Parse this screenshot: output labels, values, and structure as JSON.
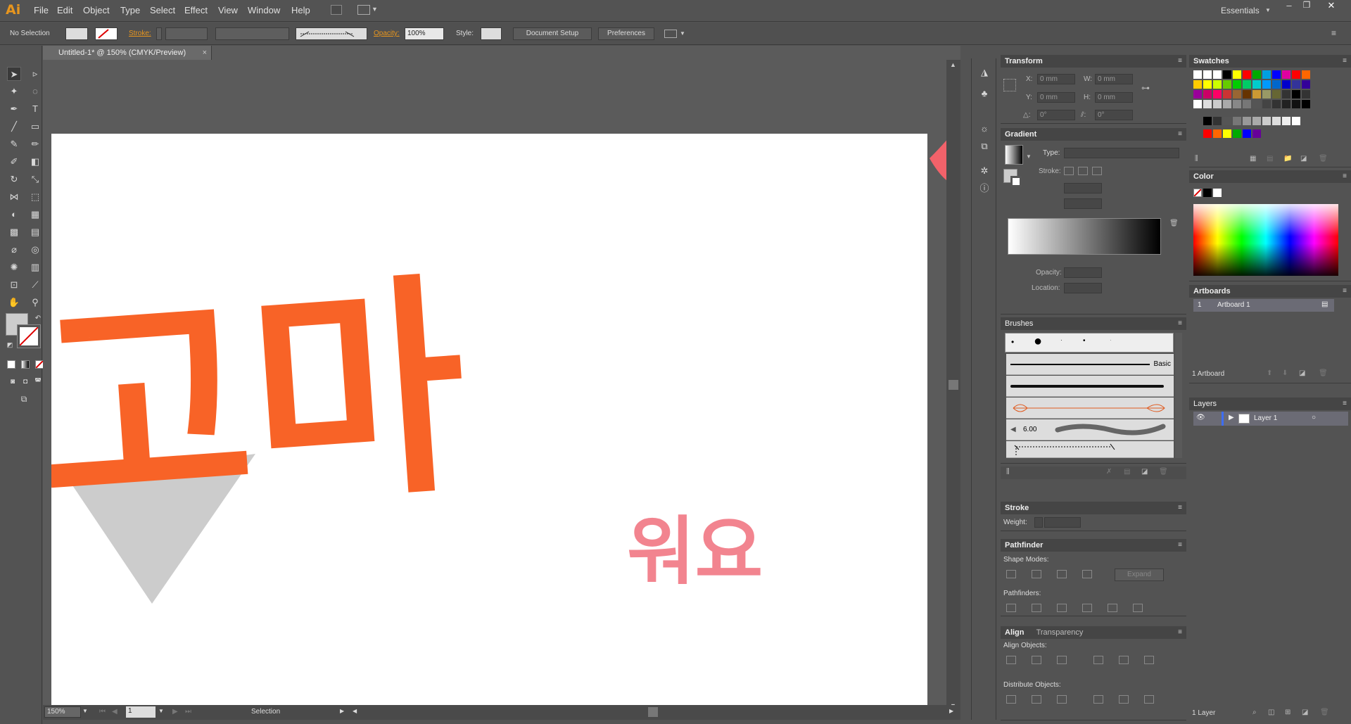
{
  "app": {
    "logo": "Ai",
    "workspace": "Essentials"
  },
  "menu": [
    "File",
    "Edit",
    "Object",
    "Type",
    "Select",
    "Effect",
    "View",
    "Window",
    "Help"
  ],
  "control": {
    "selection": "No Selection",
    "stroke_label": "Stroke:",
    "opacity_label": "Opacity:",
    "opacity_value": "100%",
    "style_label": "Style:",
    "doc_setup": "Document Setup",
    "preferences": "Preferences"
  },
  "document": {
    "tab_title": "Untitled-1* @ 150% (CMYK/Preview)"
  },
  "artwork": {
    "text1": "고마",
    "text2": "워요",
    "colors": {
      "orange": "#f86327",
      "pink": "#f2848f",
      "gray": "#cccccc"
    }
  },
  "status": {
    "zoom": "150%",
    "artboard_num": "1",
    "tool": "Selection"
  },
  "transform": {
    "title": "Transform",
    "x_label": "X:",
    "y_label": "Y:",
    "w_label": "W:",
    "h_label": "H:",
    "x": "0 mm",
    "y": "0 mm",
    "w": "0 mm",
    "h": "0 mm",
    "angle": "0°",
    "shear": "0°"
  },
  "gradient": {
    "title": "Gradient",
    "type_label": "Type:",
    "stroke_label": "Stroke:",
    "opacity_label": "Opacity:",
    "location_label": "Location:"
  },
  "brushes": {
    "title": "Brushes",
    "basic": "Basic",
    "size": "6.00"
  },
  "stroke": {
    "title": "Stroke",
    "weight_label": "Weight:"
  },
  "pathfinder": {
    "title": "Pathfinder",
    "shape_modes": "Shape Modes:",
    "pathfinders": "Pathfinders:",
    "expand": "Expand"
  },
  "align": {
    "title": "Align",
    "tab2": "Transparency",
    "align_objects": "Align Objects:",
    "distribute_objects": "Distribute Objects:"
  },
  "swatches": {
    "title": "Swatches"
  },
  "color": {
    "title": "Color"
  },
  "artboards": {
    "title": "Artboards",
    "row_num": "1",
    "row_name": "Artboard 1",
    "count": "1 Artboard"
  },
  "layers": {
    "title": "Layers",
    "layer_name": "Layer 1",
    "count": "1 Layer"
  }
}
